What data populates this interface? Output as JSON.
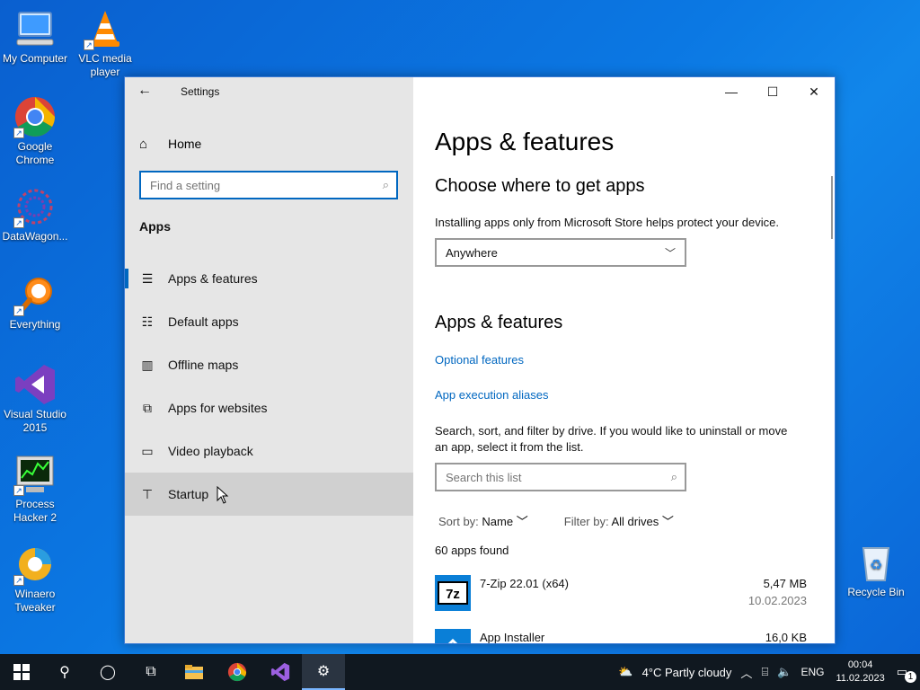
{
  "desktop": {
    "icons": [
      {
        "label": "My Computer"
      },
      {
        "label": "VLC media player"
      },
      {
        "label": "Google Chrome"
      },
      {
        "label": "DataWagon..."
      },
      {
        "label": "Everything"
      },
      {
        "label": "Visual Studio 2015"
      },
      {
        "label": "Process Hacker 2"
      },
      {
        "label": "Winaero Tweaker"
      },
      {
        "label": "Recycle Bin"
      }
    ]
  },
  "window": {
    "title": "Settings",
    "sidebar": {
      "home": "Home",
      "search_placeholder": "Find a setting",
      "section": "Apps",
      "items": [
        {
          "label": "Apps & features",
          "icon": "list-icon"
        },
        {
          "label": "Default apps",
          "icon": "default-apps-icon"
        },
        {
          "label": "Offline maps",
          "icon": "map-icon"
        },
        {
          "label": "Apps for websites",
          "icon": "open-in-icon"
        },
        {
          "label": "Video playback",
          "icon": "video-icon"
        },
        {
          "label": "Startup",
          "icon": "startup-icon"
        }
      ]
    },
    "content": {
      "heading": "Apps & features",
      "choose_heading": "Choose where to get apps",
      "choose_desc": "Installing apps only from Microsoft Store helps protect your device.",
      "dropdown_value": "Anywhere",
      "section_heading": "Apps & features",
      "link_optional": "Optional features",
      "link_aliases": "App execution aliases",
      "search_desc": "Search, sort, and filter by drive. If you would like to uninstall or move an app, select it from the list.",
      "list_search_placeholder": "Search this list",
      "sort_label": "Sort by:",
      "sort_value": "Name",
      "filter_label": "Filter by:",
      "filter_value": "All drives",
      "apps_found": "60 apps found",
      "apps": [
        {
          "name": "7-Zip 22.01 (x64)",
          "size": "5,47 MB",
          "date": "10.02.2023"
        },
        {
          "name": "App Installer",
          "size": "16,0 KB",
          "date": ""
        }
      ]
    }
  },
  "taskbar": {
    "weather": "4°C  Partly cloudy",
    "language": "ENG",
    "time": "00:04",
    "date": "11.02.2023",
    "notifications": "1"
  }
}
